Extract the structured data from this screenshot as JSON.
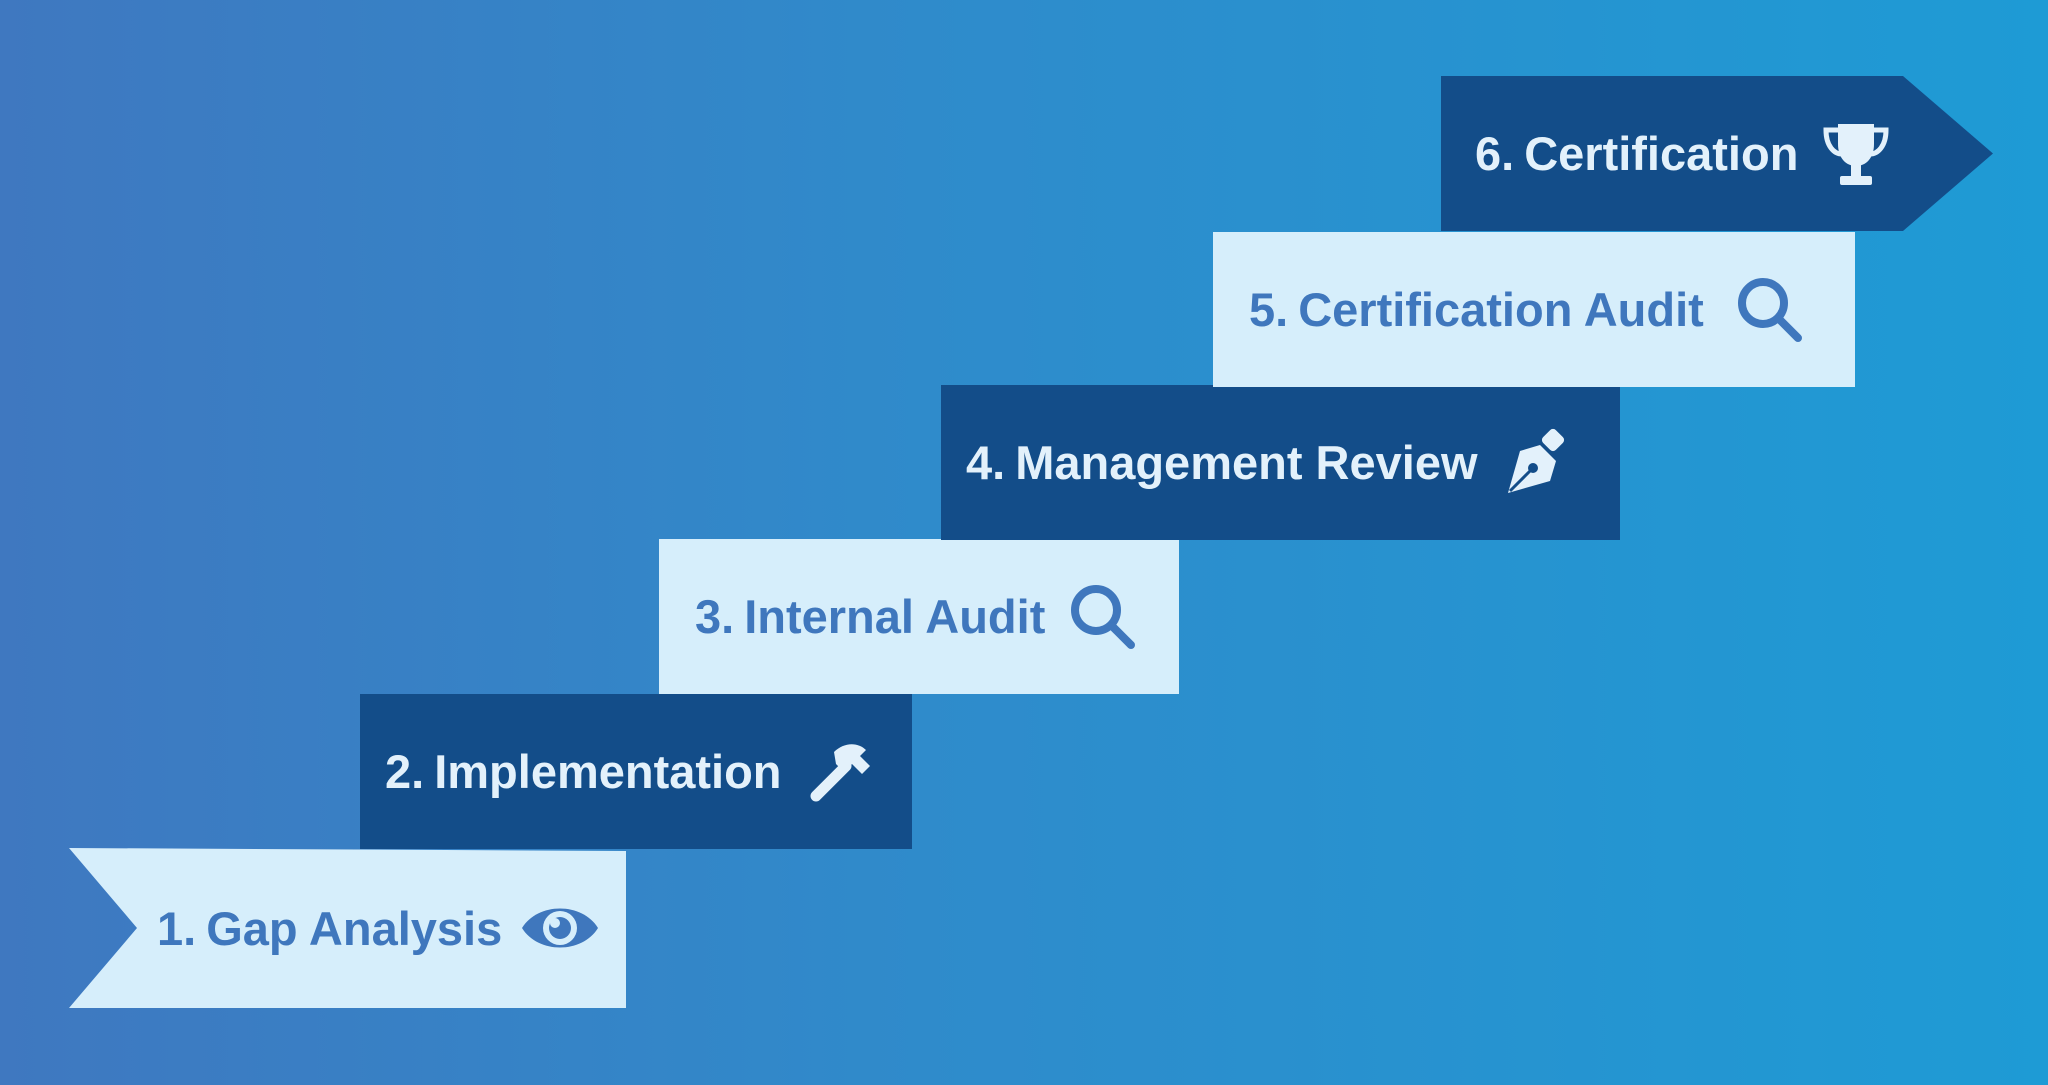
{
  "steps": [
    {
      "number": "1.",
      "label": "Gap Analysis",
      "icon": "eye-icon",
      "theme": "light"
    },
    {
      "number": "2.",
      "label": "Implementation",
      "icon": "hammer-icon",
      "theme": "dark"
    },
    {
      "number": "3.",
      "label": "Internal Audit",
      "icon": "search-icon",
      "theme": "light"
    },
    {
      "number": "4.",
      "label": "Management Review",
      "icon": "pen-nib-icon",
      "theme": "dark"
    },
    {
      "number": "5.",
      "label": "Certification Audit",
      "icon": "search-icon",
      "theme": "light"
    },
    {
      "number": "6.",
      "label": "Certification",
      "icon": "trophy-icon",
      "theme": "dark"
    }
  ],
  "colors": {
    "background_left": "#3f78c0",
    "background_right": "#1e9bd5",
    "light_box": "#d6eefb",
    "light_text": "#3f77bd",
    "dark_box": "#134d89",
    "dark_text": "#e3f1fb"
  }
}
